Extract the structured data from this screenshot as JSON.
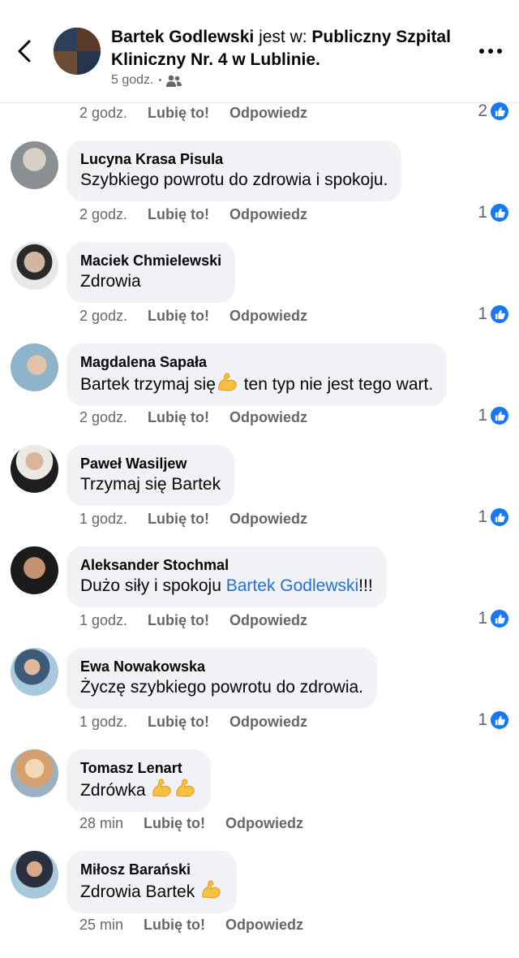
{
  "header": {
    "author": "Bartek Godlewski",
    "joiner": " jest w: ",
    "place": "Publiczny Szpital Kliniczny Nr. 4 w Lublinie.",
    "time": "5 godz.",
    "dot": "•"
  },
  "top_row": {
    "time": "2 godz.",
    "like": "Lubię to!",
    "reply": "Odpowiedz",
    "count": "2"
  },
  "comments": [
    {
      "author": "Lucyna Krasa Pisula",
      "text": "Szybkiego powrotu do zdrowia i spokoju.",
      "time": "2 godz.",
      "like": "Lubię to!",
      "reply": "Odpowiedz",
      "count": "1"
    },
    {
      "author": "Maciek Chmielewski",
      "text": "Zdrowia",
      "time": "2 godz.",
      "like": "Lubię to!",
      "reply": "Odpowiedz",
      "count": "1"
    },
    {
      "author": "Magdalena Sapała",
      "text_before": "Bartek trzymaj się",
      "text_after": " ten typ nie jest tego wart.",
      "emoji": "flexed-biceps",
      "time": "2 godz.",
      "like": "Lubię to!",
      "reply": "Odpowiedz",
      "count": "1"
    },
    {
      "author": "Paweł Wasiljew",
      "text": "Trzymaj się Bartek",
      "time": "1 godz.",
      "like": "Lubię to!",
      "reply": "Odpowiedz",
      "count": "1"
    },
    {
      "author": "Aleksander Stochmal",
      "text_before": "Dużo siły i spokoju ",
      "mention": "Bartek Godlewski",
      "text_after": "!!!",
      "time": "1 godz.",
      "like": "Lubię to!",
      "reply": "Odpowiedz",
      "count": "1"
    },
    {
      "author": "Ewa Nowakowska",
      "text": "Życzę szybkiego powrotu do zdrowia.",
      "time": "1 godz.",
      "like": "Lubię to!",
      "reply": "Odpowiedz",
      "count": "1"
    },
    {
      "author": "Tomasz Lenart",
      "text": "Zdrówka",
      "emoji": "flexed-biceps x2",
      "time": "28 min",
      "like": "Lubię to!",
      "reply": "Odpowiedz"
    },
    {
      "author": "Miłosz Barański",
      "text": "Zdrowia Bartek",
      "emoji": "flexed-biceps",
      "time": "25 min",
      "like": "Lubię to!",
      "reply": "Odpowiedz"
    }
  ],
  "colors": {
    "accent": "#1877f2",
    "bubble": "#f0f2f5",
    "muted": "#65676b",
    "mention": "#216fdb"
  },
  "icons": [
    "back-chevron-icon",
    "people-icon",
    "more-dots-icon",
    "like-thumb-icon",
    "flexed-biceps-emoji"
  ]
}
